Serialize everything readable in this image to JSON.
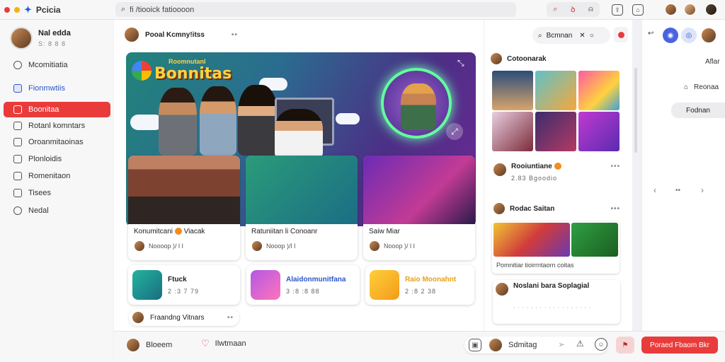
{
  "topbar": {
    "app_name": "Pcicia",
    "search_text": "fi /tiooick fatioooon",
    "icon_badge": "ꝺ"
  },
  "sidebar": {
    "profile_name": "Nal edda",
    "profile_sub": "S: 8 8 8",
    "items": [
      {
        "label": "Mcomitiatia",
        "icon": "circle-icon"
      },
      {
        "label": "Fionmwtiis",
        "icon": "grid-icon"
      },
      {
        "label": "Boonitaa",
        "icon": "star-icon"
      },
      {
        "label": "Rotanl komntars",
        "icon": "folder-icon"
      },
      {
        "label": "Oroanmitaoinas",
        "icon": "box-icon"
      },
      {
        "label": "Plonloidis",
        "icon": "document-icon"
      },
      {
        "label": "Romenitaon",
        "icon": "bookmark-icon"
      },
      {
        "label": "Tisees",
        "icon": "card-icon"
      },
      {
        "label": "Nedal",
        "icon": "chat-icon"
      }
    ]
  },
  "feed": {
    "header_title": "Pooal Kcmny!itss",
    "header_more": "••",
    "hero_title": "Bonnitas",
    "hero_subtitle": "Roomnutanl",
    "tiles": [
      {
        "label": "Konumitcani",
        "label_suffix": "Viacak",
        "meta": "Noooop )/  l  I"
      },
      {
        "label": "Ratuniitan li Conoanr",
        "label_suffix": "",
        "meta": "Nooop )/l  I"
      },
      {
        "label": "Saiw Miar",
        "label_suffix": "",
        "meta": "Nooop )/  l  I"
      }
    ],
    "small_cards": [
      {
        "title": "Ftuck",
        "sub": "2 :3 7 79"
      },
      {
        "title": "Alaidonmunitfana",
        "sub": "3 :8 :8 88"
      },
      {
        "title": "Raio Moonahnt",
        "sub": "2 :8 2 38"
      }
    ],
    "pill_label": "Fraandng Vitnars",
    "pill_more": "••"
  },
  "right": {
    "search_label": "Bcmnan",
    "section1_title": "Cotoonarak",
    "post1_title": "Rooiuntiane",
    "post1_sub": "2.83 Bgoodio",
    "section2_title": "Rodac Saitan",
    "caption": "Pomnitiar tioirrntaorn coitas",
    "post2_title": "Noslani bara Soplagial",
    "post2_sub": "· · · · · · · · · · · · · · · · · ·",
    "more": "•••"
  },
  "farright": {
    "line1": "Aflar",
    "line2": "Reonaa",
    "button": "Fodnan"
  },
  "bottombar": {
    "item1": "Bloeem",
    "item2": "Ilwtmaan",
    "item3": "Sdmitag",
    "cta": "Poraed Fbaom Bkr"
  }
}
